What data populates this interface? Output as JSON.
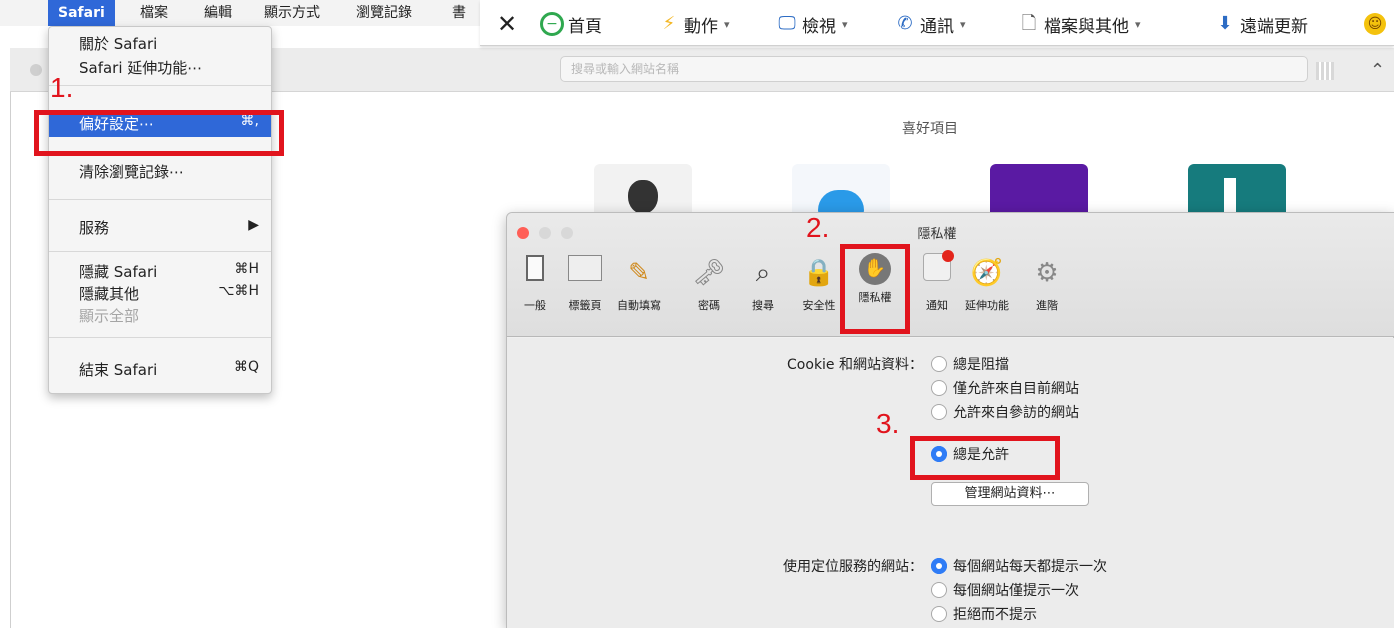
{
  "menubar": {
    "app_name": "Safari",
    "items": [
      "檔案",
      "編輯",
      "顯示方式",
      "瀏覽記錄",
      "書"
    ]
  },
  "safari_menu": {
    "items": [
      {
        "label": "關於 Safari",
        "shortcut": ""
      },
      {
        "label": "Safari 延伸功能⋯",
        "shortcut": ""
      },
      {
        "label": "偏好設定⋯",
        "shortcut": "⌘,"
      },
      {
        "label": "清除瀏覽記錄⋯",
        "shortcut": ""
      },
      {
        "label": "服務",
        "shortcut": "▶"
      },
      {
        "label": "隱藏 Safari",
        "shortcut": "⌘H"
      },
      {
        "label": "隱藏其他",
        "shortcut": "⌥⌘H"
      },
      {
        "label": "顯示全部",
        "shortcut": ""
      },
      {
        "label": "結束 Safari",
        "shortcut": "⌘Q"
      }
    ]
  },
  "top_toolbar": {
    "home": "首頁",
    "actions": "動作",
    "view": "檢視",
    "comm": "通訊",
    "files": "檔案與其他",
    "remote_update": "遠端更新"
  },
  "browser": {
    "address_placeholder": "搜尋或輸入網站名稱",
    "favorites_title": "喜好項目"
  },
  "steps": {
    "one": "1.",
    "two": "2.",
    "three": "3."
  },
  "prefs": {
    "title": "隱私權",
    "tabs": [
      "一般",
      "標籤頁",
      "自動填寫",
      "密碼",
      "搜尋",
      "安全性",
      "隱私權",
      "通知",
      "延伸功能",
      "進階"
    ],
    "selected_tab": "隱私權",
    "cookie_label": "Cookie 和網站資料：",
    "cookie_options": [
      "總是阻擋",
      "僅允許來自目前網站",
      "允許來自參訪的網站",
      "總是允許"
    ],
    "cookie_selected": "總是允許",
    "manage_button": "管理網站資料⋯",
    "location_label": "使用定位服務的網站：",
    "location_options": [
      "每個網站每天都提示一次",
      "每個網站僅提示一次",
      "拒絕而不提示"
    ],
    "location_selected": "每個網站每天都提示一次"
  },
  "colors": {
    "accent": "#2f68d8",
    "annotation_red": "#e1141d",
    "radio_on": "#2f7cf6"
  },
  "icons": {
    "apple": "apple-icon",
    "close": "close-icon",
    "home": "home-icon",
    "bolt": "bolt-icon",
    "view": "monitor-icon",
    "comm": "phone-icon",
    "files": "file-icon",
    "download": "download-icon",
    "smiley": "smiley-icon"
  }
}
